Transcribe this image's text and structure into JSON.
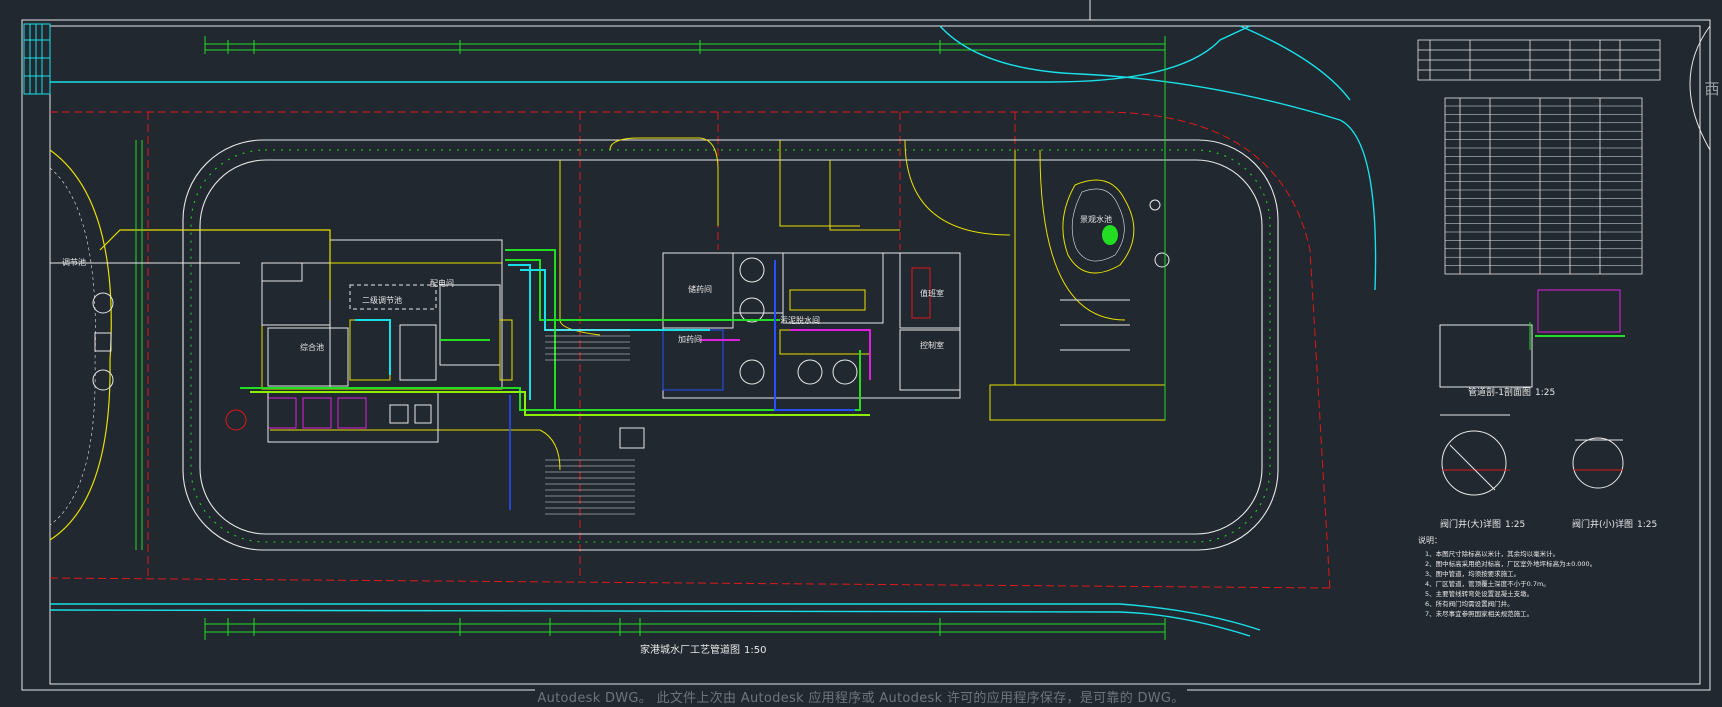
{
  "viewport": {
    "status_message": "Autodesk DWG。  此文件上次由 Autodesk 应用程序或 Autodesk 许可的应用程序保存，是可靠的 DWG。",
    "right_tab_label": "西"
  },
  "drawing": {
    "title": "家港城水厂工艺管道图",
    "title_scale": "1:50",
    "section_title": "管道剖-1剖面图",
    "section_scale": "1:25",
    "detail_left_title": "阀门井(大)详图",
    "detail_left_scale": "1:25",
    "detail_right_title": "阀门井(小)详图",
    "detail_right_scale": "1:25",
    "notes_title": "说明：",
    "notes": [
      "1、本图尺寸除标高以米计，其余均以毫米计。",
      "2、图中标高采用绝对标高，厂区室外地坪标高为±0.000。",
      "3、图中管道，均须按要求施工。",
      "4、厂区管道，管顶覆土深度不小于0.7m。",
      "5、主要管线转弯处设置混凝土支墩。",
      "6、所有阀门均需设置阀门井。",
      "7、未尽事宜参照国家相关规范施工。"
    ],
    "labels": {
      "left_pool": "调节池",
      "pond": "景观水池",
      "room_a": "二级调节池",
      "room_b": "配电间",
      "room_c": "值班室",
      "room_d": "控制室",
      "room_e": "污泥脱水间",
      "room_f": "储药间",
      "room_g": "加药间",
      "room_h": "综合池"
    }
  },
  "colors": {
    "bg": "#212830",
    "white": "#e8e8e8",
    "green": "#22dd22",
    "lime": "#8cf000",
    "cyan": "#19e0e8",
    "yellow": "#e8e000",
    "red": "#e01818",
    "blue": "#2450ff",
    "magenta": "#e020e0",
    "orange": "#e09a20"
  }
}
